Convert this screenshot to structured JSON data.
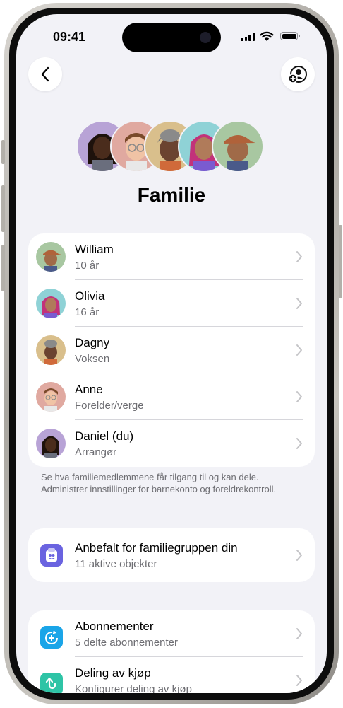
{
  "status_bar": {
    "time": "09:41"
  },
  "header": {
    "back_icon": "chevron-left-icon",
    "add_member_icon": "person-add-icon"
  },
  "page": {
    "title": "Familie"
  },
  "members": [
    {
      "name": "William",
      "role": "10 år",
      "avatar_color": "#a8c7a1"
    },
    {
      "name": "Olivia",
      "role": "16 år",
      "avatar_color": "#8fd2d6"
    },
    {
      "name": "Dagny",
      "role": "Voksen",
      "avatar_color": "#d9bf8c"
    },
    {
      "name": "Anne",
      "role": "Forelder/verge",
      "avatar_color": "#e0a9a0"
    },
    {
      "name": "Daniel (du)",
      "role": "Arrangør",
      "avatar_color": "#b8a3d6"
    }
  ],
  "members_footer": "Se hva familiemedlemmene får tilgang til og kan dele. Administrer innstillinger for barnekonto og foreldrekontroll.",
  "recommended": {
    "title": "Anbefalt for familiegruppen din",
    "subtitle": "11 aktive objekter",
    "icon": "family-checklist-icon",
    "icon_color": "#6a63e0"
  },
  "sharing": [
    {
      "title": "Abonnementer",
      "subtitle": "5 delte abonnementer",
      "icon": "subscriptions-icon",
      "icon_color": "#1aa5e8"
    },
    {
      "title": "Deling av kjøp",
      "subtitle": "Konfigurer deling av kjøp",
      "icon": "purchase-sharing-icon",
      "icon_color": "#2ec4a6"
    }
  ]
}
